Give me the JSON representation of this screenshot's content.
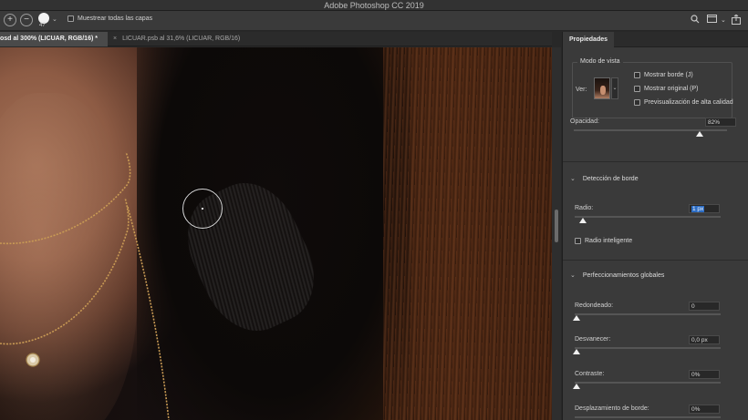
{
  "app": {
    "title": "Adobe Photoshop CC 2019"
  },
  "options_bar": {
    "brush_size": "47",
    "sample_all_layers_label": "Muestrear todas las capas",
    "icons": [
      "add-circle-icon",
      "subtract-circle-icon",
      "search-icon",
      "window-icon",
      "share-icon"
    ]
  },
  "tabs": [
    {
      "label": "osd al 300% (LICUAR, RGB/16) *",
      "active": true
    },
    {
      "label": "LICUAR.psb al 31,6% (LICUAR, RGB/16)",
      "active": false,
      "close": "×"
    }
  ],
  "panel": {
    "tab": "Propiedades",
    "view_mode": {
      "title": "Modo de vista",
      "ver_label": "Ver:",
      "show_edge": "Mostrar borde (J)",
      "show_original": "Mostrar original (P)",
      "hq_preview": "Previsualización de alta calidad"
    },
    "opacity": {
      "label": "Opacidad:",
      "value": "82%",
      "level": 0.82
    },
    "edge_detection": {
      "title": "Detección de borde",
      "radius_label": "Radio:",
      "radius_value": "1 px",
      "radius_level": 0.0,
      "smart_radius": "Radio inteligente"
    },
    "global_refinements": {
      "title": "Perfeccionamientos globales",
      "smooth_label": "Redondeado:",
      "smooth_value": "0",
      "smooth_level": 0.0,
      "feather_label": "Desvanecer:",
      "feather_value": "0,0 px",
      "feather_level": 0.0,
      "contrast_label": "Contraste:",
      "contrast_value": "0%",
      "contrast_level": 0.0,
      "shift_edge_label": "Desplazamiento de borde:",
      "shift_edge_value": "0%"
    }
  }
}
